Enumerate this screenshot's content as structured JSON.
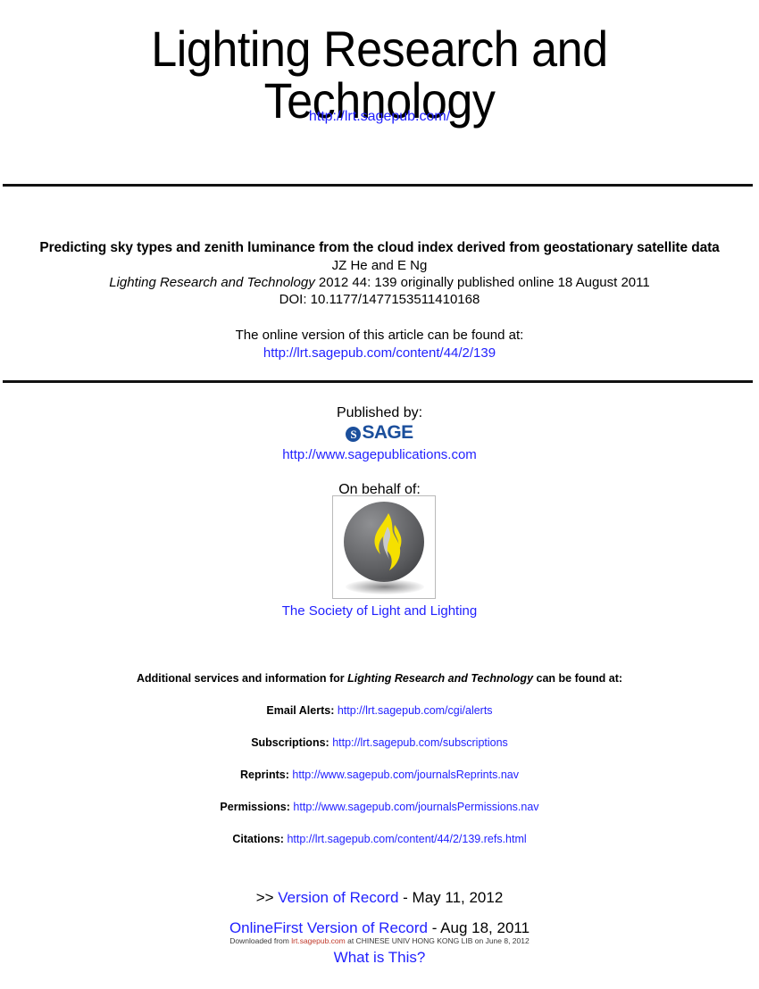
{
  "masthead": {
    "title_line_1": "Lighting Research and",
    "title_line_2": "Technology",
    "url": "http://lrt.sagepub.com/"
  },
  "article": {
    "title": "Predicting sky types and zenith luminance from the cloud index derived from geostationary satellite data",
    "authors": "JZ He and E Ng",
    "journal_name": "Lighting Research and Technology",
    "citation_rest": "2012 44: 139 originally published online 18 August 2011",
    "doi": "DOI: 10.1177/1477153511410168",
    "online_version_label": "The online version of this article can be found at:",
    "online_version_url": "http://lrt.sagepub.com/content/44/2/139"
  },
  "publisher": {
    "published_by_label": "Published by:",
    "logo_mark": "sage-circle-s-icon",
    "logo_word": "SAGE",
    "url": "http://www.sagepublications.com",
    "on_behalf_label": "On behalf of:",
    "society_logo": "flame-sphere-icon",
    "society_name": "The Society of Light and Lighting"
  },
  "services": {
    "heading_before": "Additional services and information for",
    "heading_journal": "Lighting Research and Technology",
    "heading_after": "can be found at:",
    "rows": [
      {
        "label": "Email Alerts:",
        "url": "http://lrt.sagepub.com/cgi/alerts"
      },
      {
        "label": "Subscriptions:",
        "url": "http://lrt.sagepub.com/subscriptions"
      },
      {
        "label": "Reprints:",
        "url": "http://www.sagepub.com/journalsReprints.nav"
      },
      {
        "label": "Permissions:",
        "url": "http://www.sagepub.com/journalsPermissions.nav"
      },
      {
        "label": "Citations:",
        "url": "http://lrt.sagepub.com/content/44/2/139.refs.html"
      }
    ]
  },
  "versions": {
    "chevrons": ">>",
    "record_link": "Version of Record",
    "record_date": "- May 11, 2012",
    "onlinefirst_link": "OnlineFirst Version of Record",
    "onlinefirst_date": "- Aug 18, 2011",
    "what_is_this": "What is This?"
  },
  "watermark": {
    "prefix": "Downloaded from",
    "url": "lrt.sagepub.com",
    "suffix": "at CHINESE UNIV HONG KONG LIB on June 8, 2012"
  },
  "colors": {
    "link_blue": "#2222ff",
    "sage_blue": "#1b4f9c",
    "watermark_red": "#c0392b",
    "flame_yellow": "#f5e000"
  }
}
